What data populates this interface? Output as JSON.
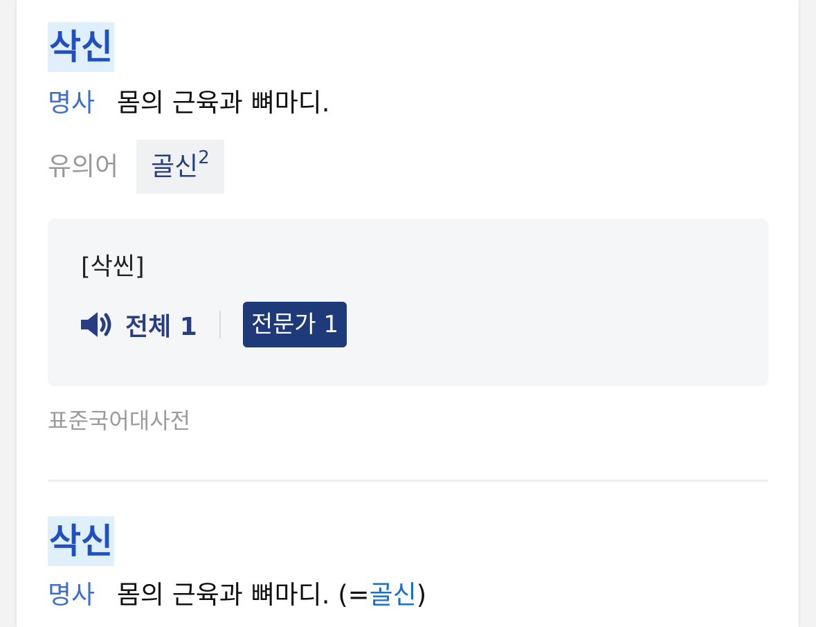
{
  "entries": [
    {
      "headword": "삭신",
      "pos": "명사",
      "definition": "몸의 근육과 뼈마디.",
      "synonym_label": "유의어",
      "synonym": {
        "word": "골신",
        "sup": "2"
      },
      "pronunciation": "[삭씬]",
      "audio": {
        "all_label": "전체 1",
        "expert_label": "전문가 1"
      },
      "source": "표준국어대사전"
    },
    {
      "headword": "삭신",
      "pos": "명사",
      "definition": "몸의 근육과 뼈마디.",
      "ref_open": " (=",
      "ref_word": "골신",
      "ref_close": ")"
    }
  ],
  "colors": {
    "headword_bg": "#dfeffb",
    "headword_text": "#1f4fc0",
    "pos_text": "#3a6fd0",
    "chip_text": "#283e84",
    "expert_bg": "#1f3a78",
    "link": "#1570d6"
  },
  "icons": {
    "speaker": "speaker-icon"
  }
}
